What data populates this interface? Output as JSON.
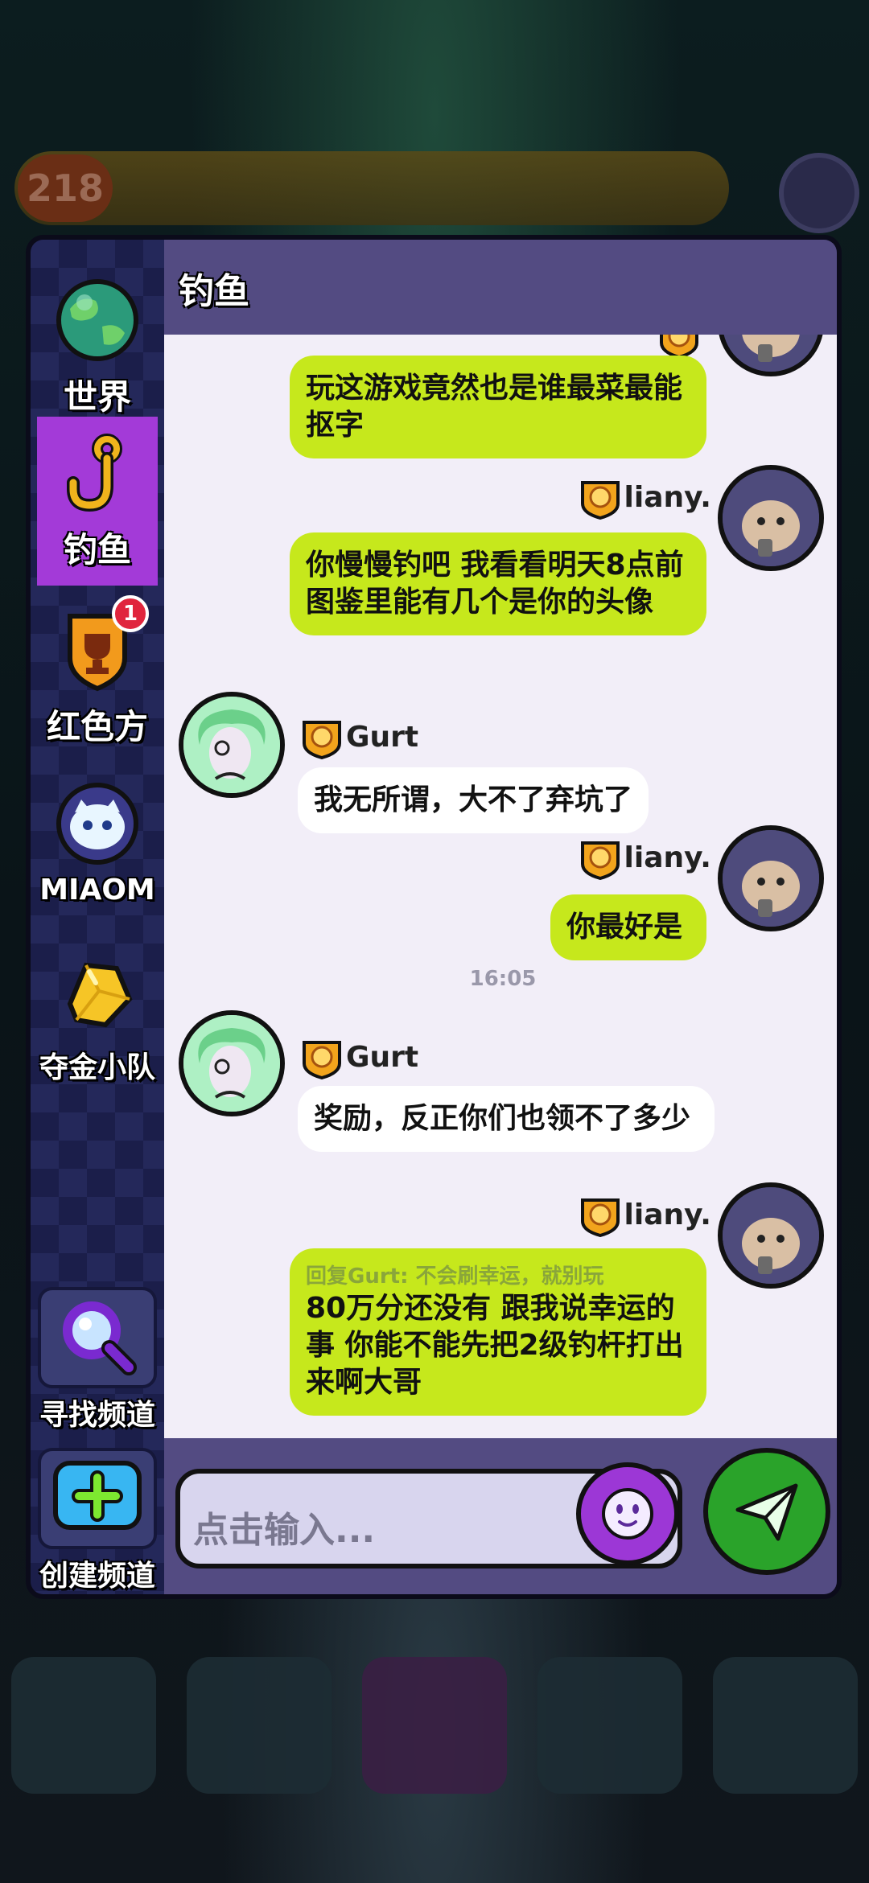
{
  "background": {
    "level": "218"
  },
  "sidebar": {
    "items": [
      {
        "label": "世界",
        "icon": "globe-icon",
        "active": false
      },
      {
        "label": "钓鱼",
        "icon": "fishing-hook-icon",
        "active": true
      },
      {
        "label": "红色方",
        "icon": "trophy-shield-icon",
        "badge": "1",
        "active": false
      },
      {
        "label": "MIAOM",
        "icon": "ghost-cat-icon",
        "active": false
      },
      {
        "label": "夺金小队",
        "icon": "gold-nugget-icon",
        "active": false
      }
    ],
    "find_channel_label": "寻找频道",
    "create_channel_label": "创建频道"
  },
  "chat": {
    "title": "钓鱼",
    "messages": [
      {
        "sender": "liany.",
        "side": "right",
        "text": "玩这游戏竟然也是谁最菜最能抠字"
      },
      {
        "sender": "liany.",
        "side": "right",
        "text": "你慢慢钓吧 我看看明天8点前图鉴里能有几个是你的头像"
      },
      {
        "sender": "Gurt",
        "side": "left",
        "text": "我无所谓，大不了弃坑了"
      },
      {
        "sender": "liany.",
        "side": "right",
        "text": "你最好是"
      },
      {
        "timestamp": "16:05"
      },
      {
        "sender": "Gurt",
        "side": "left",
        "text": "奖励，反正你们也领不了多少"
      },
      {
        "sender": "liany.",
        "side": "right",
        "reply": "回复Gurt: 不会刷幸运，就别玩",
        "text": "80万分还没有 跟我说幸运的事 你能不能先把2级钓杆打出来啊大哥"
      }
    ]
  },
  "input": {
    "placeholder": "点击输入..."
  },
  "colors": {
    "active_tab": "#a33ad8",
    "own_bubble": "#c6e81c",
    "other_bubble": "#ffffff",
    "header": "#534b82",
    "send_button": "#2aa32a",
    "emoji_button": "#9c37d6"
  }
}
